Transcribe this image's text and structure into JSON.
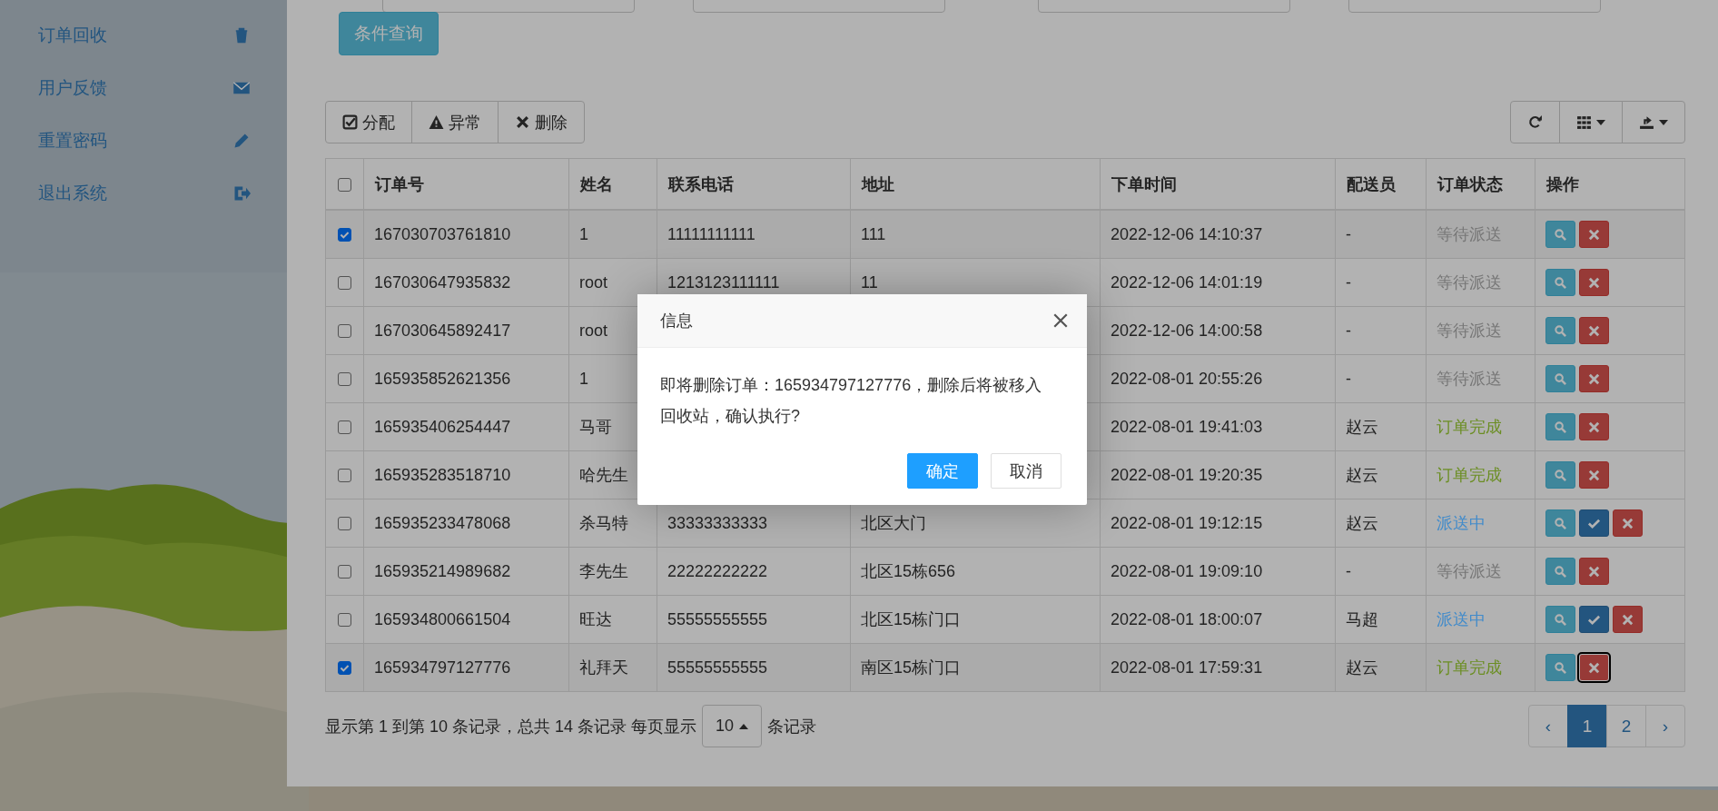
{
  "sidebar": {
    "items": [
      {
        "label": "订单回收"
      },
      {
        "label": "用户反馈"
      },
      {
        "label": "重置密码"
      },
      {
        "label": "退出系统"
      }
    ]
  },
  "search": {
    "button": "条件查询"
  },
  "toolbar": {
    "left": [
      {
        "label": "分配"
      },
      {
        "label": "异常"
      },
      {
        "label": "删除"
      }
    ]
  },
  "table": {
    "header_checked": false,
    "columns": [
      "订单号",
      "姓名",
      "联系电话",
      "地址",
      "下单时间",
      "配送员",
      "订单状态",
      "操作"
    ],
    "rows": [
      {
        "checked": true,
        "cells": [
          "167030703761810",
          "1",
          "11111111111",
          "111",
          "2022-12-06 14:10:37",
          "-"
        ],
        "status": {
          "text": "等待派送",
          "color": "#777777"
        },
        "actions": [
          {
            "kind": "view",
            "focused": false
          },
          {
            "kind": "delete",
            "focused": false
          }
        ]
      },
      {
        "checked": false,
        "cells": [
          "167030647935832",
          "root",
          "1213123111111",
          "11",
          "2022-12-06 14:01:19",
          "-"
        ],
        "status": {
          "text": "等待派送",
          "color": "#777777"
        },
        "actions": [
          {
            "kind": "view",
            "focused": false
          },
          {
            "kind": "delete",
            "focused": false
          }
        ]
      },
      {
        "checked": false,
        "cells": [
          "167030645892417",
          "root",
          "",
          "",
          "2022-12-06 14:00:58",
          "-"
        ],
        "status": {
          "text": "等待派送",
          "color": "#777777"
        },
        "actions": [
          {
            "kind": "view",
            "focused": false
          },
          {
            "kind": "delete",
            "focused": false
          }
        ]
      },
      {
        "checked": false,
        "cells": [
          "165935852621356",
          "1",
          "",
          "",
          "2022-08-01 20:55:26",
          "-"
        ],
        "status": {
          "text": "等待派送",
          "color": "#777777"
        },
        "actions": [
          {
            "kind": "view",
            "focused": false
          },
          {
            "kind": "delete",
            "focused": false
          }
        ]
      },
      {
        "checked": false,
        "cells": [
          "165935406254447",
          "马哥",
          "",
          "",
          "2022-08-01 19:41:03",
          "赵云"
        ],
        "status": {
          "text": "订单完成",
          "color": "#6b8e23"
        },
        "actions": [
          {
            "kind": "view",
            "focused": false
          },
          {
            "kind": "delete",
            "focused": false
          }
        ]
      },
      {
        "checked": false,
        "cells": [
          "165935283518710",
          "哈先生",
          "",
          "",
          "2022-08-01 19:20:35",
          "赵云"
        ],
        "status": {
          "text": "订单完成",
          "color": "#6b8e23"
        },
        "actions": [
          {
            "kind": "view",
            "focused": false
          },
          {
            "kind": "delete",
            "focused": false
          }
        ]
      },
      {
        "checked": false,
        "cells": [
          "165935233478068",
          "杀马特",
          "33333333333",
          "北区大门",
          "2022-08-01 19:12:15",
          "赵云"
        ],
        "status": {
          "text": "派送中",
          "color": "#428bca"
        },
        "actions": [
          {
            "kind": "view",
            "focused": false
          },
          {
            "kind": "deliver",
            "focused": false
          },
          {
            "kind": "delete",
            "focused": false
          }
        ]
      },
      {
        "checked": false,
        "cells": [
          "165935214989682",
          "李先生",
          "22222222222",
          "北区15栋656",
          "2022-08-01 19:09:10",
          "-"
        ],
        "status": {
          "text": "等待派送",
          "color": "#777777"
        },
        "actions": [
          {
            "kind": "view",
            "focused": false
          },
          {
            "kind": "delete",
            "focused": false
          }
        ]
      },
      {
        "checked": false,
        "cells": [
          "165934800661504",
          "旺达",
          "55555555555",
          "北区15栋门口",
          "2022-08-01 18:00:07",
          "马超"
        ],
        "status": {
          "text": "派送中",
          "color": "#428bca"
        },
        "actions": [
          {
            "kind": "view",
            "focused": false
          },
          {
            "kind": "deliver",
            "focused": false
          },
          {
            "kind": "delete",
            "focused": false
          }
        ]
      },
      {
        "checked": true,
        "cells": [
          "165934797127776",
          "礼拜天",
          "55555555555",
          "南区15栋门口",
          "2022-08-01 17:59:31",
          "赵云"
        ],
        "status": {
          "text": "订单完成",
          "color": "#6b8e23"
        },
        "actions": [
          {
            "kind": "view",
            "focused": false
          },
          {
            "kind": "delete",
            "focused": true
          }
        ]
      }
    ]
  },
  "pagination": {
    "summary": "显示第 1 到第 10 条记录，总共 14 条记录 每页显示",
    "page_size": "10",
    "suffix": "条记录",
    "pages": [
      {
        "label": "‹",
        "selected": false
      },
      {
        "label": "1",
        "selected": true
      },
      {
        "label": "2",
        "selected": false
      },
      {
        "label": "›",
        "selected": false
      }
    ]
  },
  "dialog": {
    "title": "信息",
    "message": "即将删除订单：165934797127776，删除后将被移入回收站，确认执行?",
    "buttons": [
      {
        "label": "确定",
        "kind": "primary"
      },
      {
        "label": "取消",
        "kind": "default"
      }
    ]
  }
}
